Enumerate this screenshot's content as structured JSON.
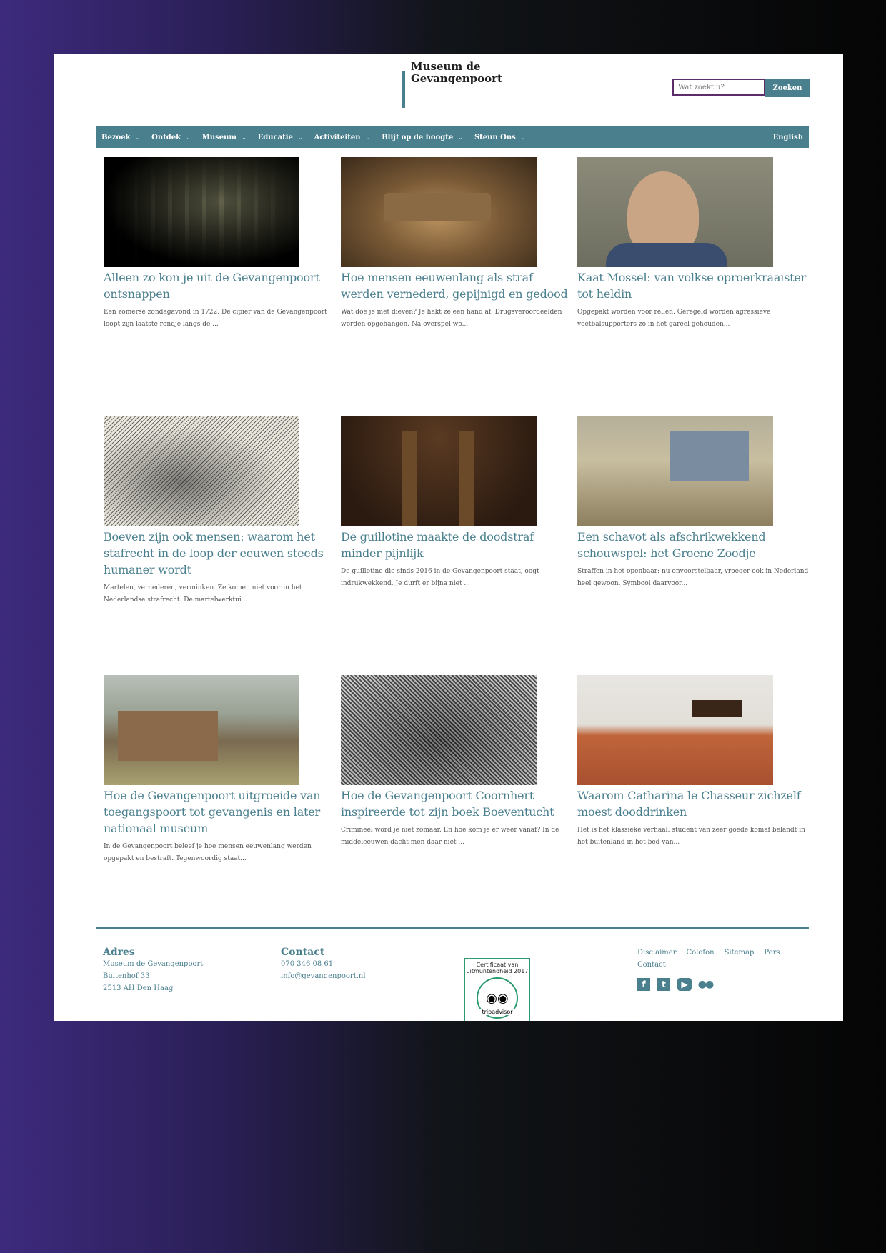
{
  "site": {
    "logo_line1": "Museum de",
    "logo_line2": "Gevangenpoort"
  },
  "search": {
    "placeholder": "Wat zoekt u?",
    "button": "Zoeken"
  },
  "nav": {
    "items": [
      "Bezoek",
      "Ontdek",
      "Museum",
      "Educatie",
      "Activiteiten",
      "Blijf op de hoogte",
      "Steun Ons"
    ],
    "language": "English"
  },
  "articles": [
    {
      "image": "prison-bars-image",
      "title": "Alleen zo kon je uit de Gevangenpoort ontsnappen",
      "excerpt": "Een zomerse zondagavond in 1722. De cipier van de Gevangenpoort loopt zijn laatste rondje langs de ..."
    },
    {
      "image": "wooden-stocks-image",
      "title": "Hoe mensen eeuwenlang als straf werden vernederd, gepijnigd en gedood",
      "excerpt": "Wat doe je met dieven? Je hakt ze een hand af. Drugsveroordeelden worden opgehangen. Na overspel wo..."
    },
    {
      "image": "portrait-image",
      "title": "Kaat Mossel: van volkse oproerkraaister tot heldin",
      "excerpt": "Opgepakt worden voor rellen. Geregeld worden agressieve voetbalsupporters zo in het gareel gehouden..."
    },
    {
      "image": "engraving-image",
      "title": "Boeven zijn ook mensen: waarom het stafrecht in de loop der eeuwen steeds humaner wordt",
      "excerpt": "Martelen, vernederen, verminken. Ze komen niet voor in het Nederlandse strafrecht. De martelwerktui..."
    },
    {
      "image": "guillotine-image",
      "title": "De guillotine maakte de doodstraf minder pijnlijk",
      "excerpt": "De guillotine die sinds 2016 in de Gevangenpoort staat, oogt indrukwekkend. Je durft er bijna niet ..."
    },
    {
      "image": "scaffold-painting-image",
      "title": "Een schavot als afschrikwekkend schouwspel: het Groene Zoodje",
      "excerpt": "Straffen in het openbaar: nu onvoorstelbaar, vroeger ook in Nederland heel gewoon. Symbool daarvoor..."
    },
    {
      "image": "square-painting-image",
      "title": "Hoe de Gevangenpoort uitgroeide van toegangspoort tot gevangenis en later nationaal museum",
      "excerpt": "In de Gevangenpoort beleef je hoe mensen eeuwenlang werden opgepakt en bestraft. Tegenwoordig staat..."
    },
    {
      "image": "crowd-engraving-image",
      "title": "Hoe de Gevangenpoort Coornhert inspireerde tot zijn boek Boeventucht",
      "excerpt": "Crimineel word je niet zomaar. En hoe kom je er weer vanaf? In de middeleeuwen dacht men daar niet ..."
    },
    {
      "image": "cell-room-image",
      "title": "Waarom Catharina le Chasseur zichzelf moest dooddrinken",
      "excerpt": "Het is het klassieke verhaal: student van zeer goede komaf belandt in het buitenland in het bed van..."
    }
  ],
  "footer": {
    "address_heading": "Adres",
    "address_lines": [
      "Museum de Gevangenpoort",
      "Buitenhof 33",
      "2513 AH Den Haag"
    ],
    "contact_heading": "Contact",
    "contact_lines": [
      "070 346 08 61",
      "info@gevangenpoort.nl"
    ],
    "links": [
      "Disclaimer",
      "Colofon",
      "Sitemap",
      "Pers",
      "Contact"
    ],
    "social": [
      "facebook-icon",
      "twitter-icon",
      "youtube-icon",
      "flickr-icon"
    ],
    "badge_text": "Certificaat van uitmuntendheid 2017",
    "badge_brand": "tripadvisor"
  },
  "colors": {
    "accent": "#4a7f8e",
    "search_border": "#5c2d6a",
    "badge_green": "#2b9a6e"
  }
}
